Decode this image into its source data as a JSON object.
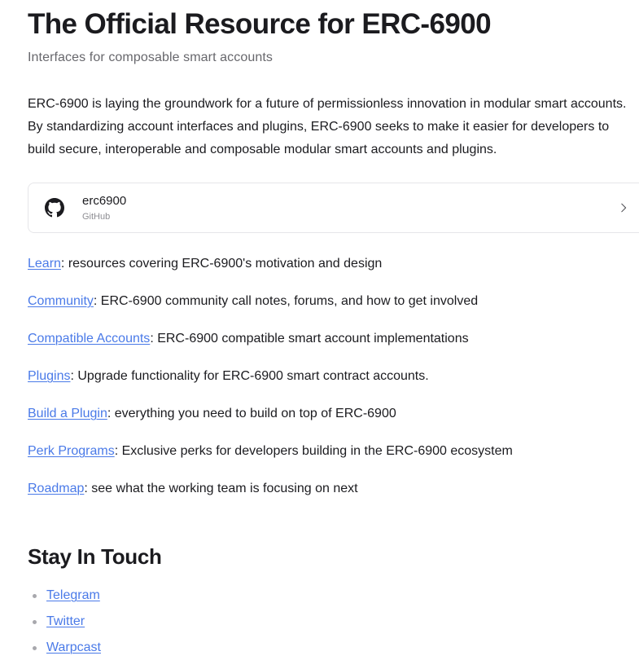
{
  "header": {
    "title": "The Official Resource for ERC-6900",
    "subtitle": "Interfaces for composable smart accounts"
  },
  "intro": {
    "paragraph": "ERC-6900 is laying the groundwork for a future of permissionless innovation in modular smart accounts. By standardizing account interfaces and plugins, ERC-6900 seeks to make it easier for developers to build secure, interoperable and composable modular smart accounts and plugins."
  },
  "github_card": {
    "icon": "github-icon",
    "title": "erc6900",
    "subtitle": "GitHub",
    "chevron_icon": "chevron-right-icon"
  },
  "resources": [
    {
      "link": "Learn",
      "description": ": resources covering ERC-6900's motivation and design"
    },
    {
      "link": "Community",
      "description": ": ERC-6900 community call notes, forums, and how to get involved"
    },
    {
      "link": "Compatible Accounts",
      "description": ": ERC-6900 compatible smart account implementations"
    },
    {
      "link": "Plugins",
      "description": ": Upgrade functionality for ERC-6900 smart contract accounts."
    },
    {
      "link": "Build a Plugin",
      "description": ": everything you need to build on top of ERC-6900"
    },
    {
      "link": "Perk Programs",
      "description": ": Exclusive perks for developers building in the ERC-6900 ecosystem"
    },
    {
      "link": "Roadmap",
      "description": ": see what the working team is focusing on next"
    }
  ],
  "stay_in_touch": {
    "heading": "Stay In Touch",
    "items": [
      {
        "label": "Telegram"
      },
      {
        "label": "Twitter"
      },
      {
        "label": "Warpcast"
      }
    ]
  },
  "colors": {
    "link": "#4a7ae8",
    "text": "#1b1b1f",
    "muted": "#67676c",
    "card_border": "#e6e6e9",
    "bullet": "#a8a8ad"
  }
}
